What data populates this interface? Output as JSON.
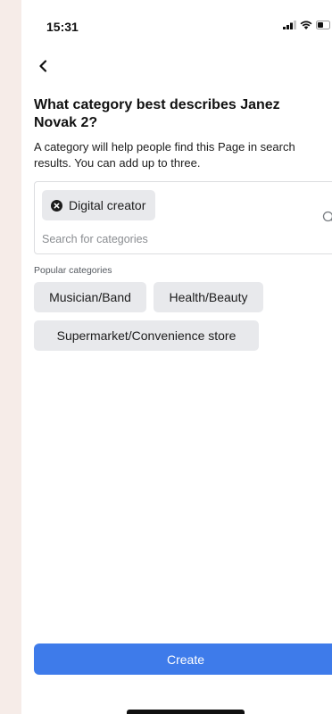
{
  "status_bar": {
    "time": "15:31",
    "icons": [
      "signal-icon",
      "wifi-icon",
      "battery-icon"
    ]
  },
  "header": {
    "back_icon": "chevron-left-icon"
  },
  "main": {
    "title": "What category best describes Janez Novak 2?",
    "subtitle": "A category will help people find this Page in search results. You can add up to three.",
    "selected_categories": [
      {
        "label": "Digital creator",
        "remove_icon": "close-circle-icon"
      }
    ],
    "search": {
      "placeholder": "Search for categories",
      "value": "",
      "icon": "search-icon"
    },
    "popular_label": "Popular categories",
    "popular_categories": [
      {
        "label": "Musician/Band"
      },
      {
        "label": "Health/Beauty"
      },
      {
        "label": "Supermarket/Convenience store"
      }
    ]
  },
  "footer": {
    "create_label": "Create"
  },
  "colors": {
    "primary_button": "#3e7bea",
    "chip_background": "#e8e9ec",
    "page_background": "#f6ece8"
  }
}
